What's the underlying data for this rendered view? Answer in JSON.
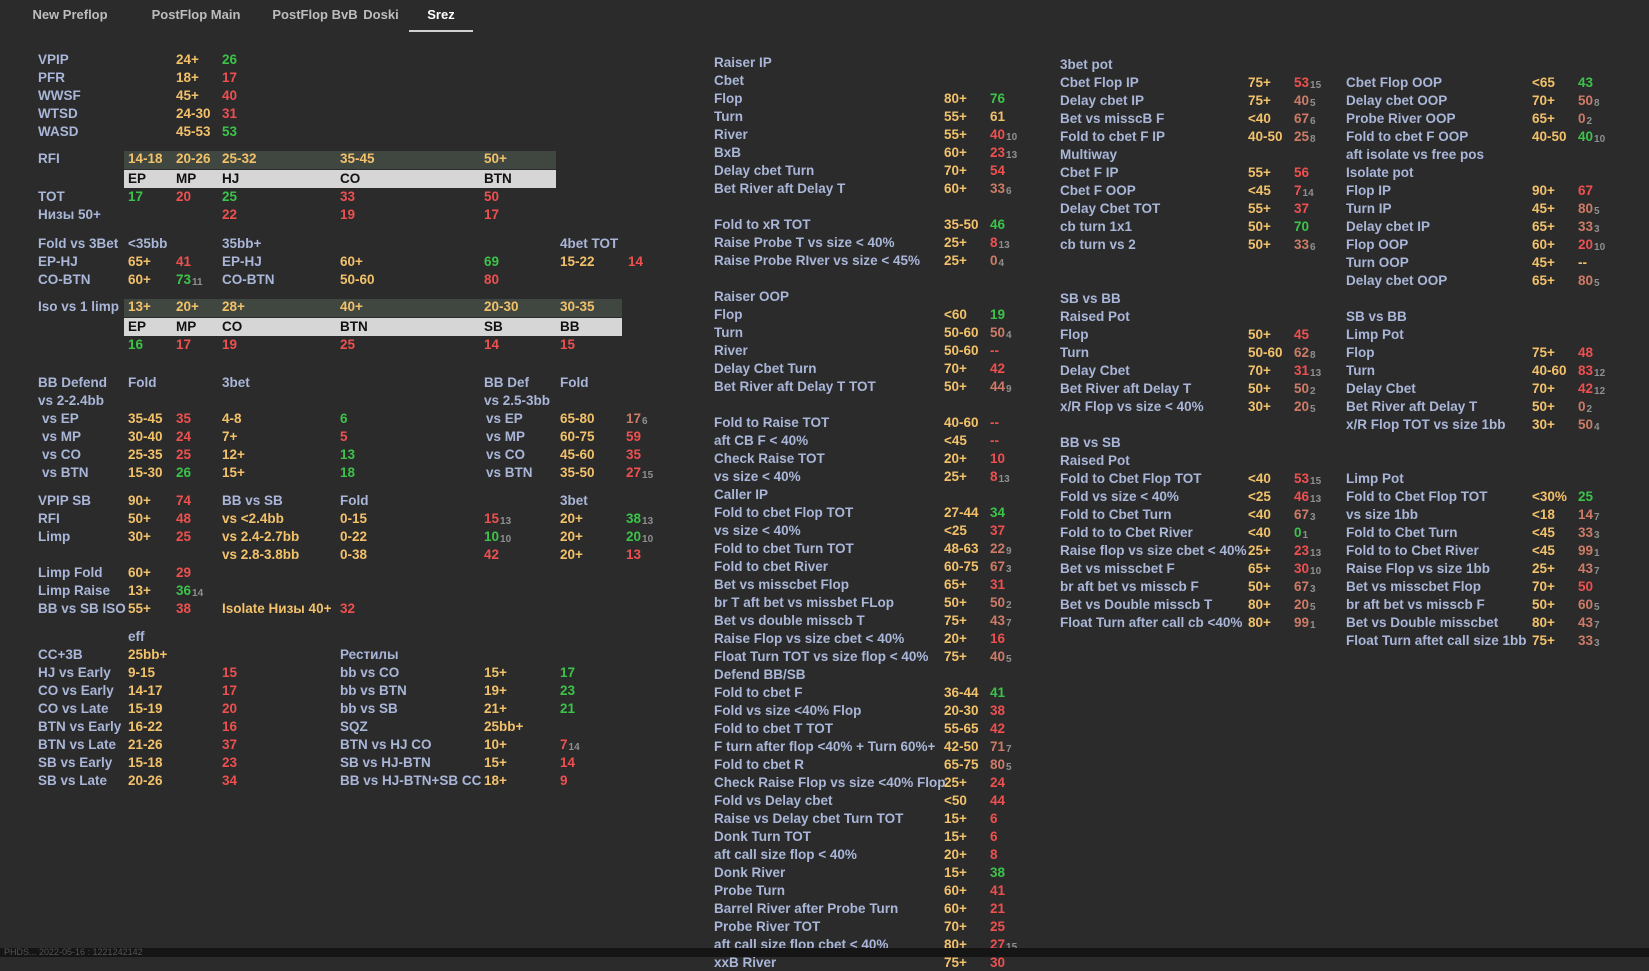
{
  "tabs": [
    {
      "label": "New Preflop"
    },
    {
      "label": "PostFlop Main"
    },
    {
      "label": "PostFlop BvB"
    },
    {
      "label": "Doski"
    },
    {
      "label": "Srez"
    }
  ],
  "top": [
    [
      "VPIP",
      "24+",
      "26",
      "g"
    ],
    [
      "PFR",
      "18+",
      "17",
      "r"
    ],
    [
      "WWSF",
      "45+",
      "40",
      "r"
    ],
    [
      "WTSD",
      "24-30",
      "31",
      "r"
    ],
    [
      "WASD",
      "45-53",
      "53",
      "g"
    ]
  ],
  "rfi": {
    "label": "RFI",
    "thr": [
      "14-18",
      "20-26",
      "25-32",
      "35-45",
      "50+"
    ],
    "pos": [
      "EP",
      "MP",
      "HJ",
      "CO",
      "BTN"
    ],
    "tot_label": "TOT",
    "tot": [
      [
        "17",
        "g"
      ],
      [
        "20",
        "r"
      ],
      [
        "25",
        "g"
      ],
      [
        "33",
        "r"
      ],
      [
        "50",
        "r"
      ]
    ],
    "niz_label": "Низы 50+",
    "niz": [
      "22",
      "19",
      "17"
    ]
  },
  "f3b": {
    "label": "Fold vs 3Bet",
    "h1": "<35bb",
    "h2": "35bb+",
    "h3": "4bet TOT",
    "ep": "EP-HJ",
    "ep_t": "65+",
    "ep_v": "41",
    "ep2": "EP-HJ",
    "ep2_t": "60+",
    "ep2_v": "69",
    "bt_t": "15-22",
    "bt_v": "14",
    "co": "CO-BTN",
    "co_t": "60+",
    "co_v": "73",
    "co_s": "11",
    "co2": "CO-BTN",
    "co2_t": "50-60",
    "co2_v": "80"
  },
  "iso": {
    "label": "Iso vs 1 limp",
    "thr": [
      "13+",
      "20+",
      "28+",
      "40+",
      "20-30",
      "30-35"
    ],
    "pos": [
      "EP",
      "MP",
      "CO",
      "BTN",
      "SB",
      "BB"
    ],
    "vals": [
      [
        "16",
        "g"
      ],
      [
        "17",
        "r"
      ],
      [
        "19",
        "r"
      ],
      [
        "25",
        "r"
      ],
      [
        "14",
        "r"
      ],
      [
        "15",
        "r"
      ]
    ]
  },
  "bbd": {
    "l1": "BB Defend",
    "l2": "vs 2-2.4bb",
    "h_fold": "Fold",
    "h_3bet": "3bet",
    "r_l1": "BB Def",
    "r_l2": "vs 2.5-3bb",
    "r_fold": "Fold",
    "rows": [
      [
        "vs EP",
        "35-45",
        "35",
        "r",
        "4-8",
        "6",
        "g",
        "vs EP",
        "65-80",
        "17",
        "p",
        "6"
      ],
      [
        "vs MP",
        "30-40",
        "24",
        "r",
        "7+",
        "5",
        "r",
        "vs MP",
        "60-75",
        "59",
        "r",
        ""
      ],
      [
        "vs CO",
        "25-35",
        "25",
        "r",
        "12+",
        "13",
        "g",
        "vs CO",
        "45-60",
        "35",
        "r",
        ""
      ],
      [
        "vs BTN",
        "15-30",
        "26",
        "g",
        "15+",
        "18",
        "g",
        "vs BTN",
        "35-50",
        "27",
        "r",
        "15"
      ]
    ]
  },
  "sb": {
    "vpip": "VPIP SB",
    "vpip_t": "90+",
    "vpip_v": "74",
    "rfi": "RFI",
    "rfi_t": "50+",
    "rfi_v": "48",
    "limp": "Limp",
    "limp_t": "30+",
    "limp_v": "25",
    "bbsb": "BB vs SB",
    "fold": "Fold",
    "threebet": "3bet",
    "rows": [
      [
        "vs <2.4bb",
        "0-15",
        "15",
        "r",
        "13",
        "20+",
        "38",
        "g",
        "13"
      ],
      [
        "vs 2.4-2.7bb",
        "0-22",
        "10",
        "g",
        "10",
        "20+",
        "20",
        "g",
        "10"
      ],
      [
        "vs 2.8-3.8bb",
        "0-38",
        "42",
        "r",
        "",
        "20+",
        "13",
        "r",
        ""
      ]
    ]
  },
  "limp": [
    [
      "Limp Fold",
      "60+",
      "29",
      "r",
      ""
    ],
    [
      "Limp Raise",
      "13+",
      "36",
      "g",
      "14"
    ],
    [
      "BB vs SB ISO",
      "55+",
      "38",
      "r",
      ""
    ]
  ],
  "isoniz": {
    "label": "Isolate Низы 40+",
    "v": "32"
  },
  "cc": {
    "eff": "eff",
    "label": "CC+3B",
    "h": "25bb+",
    "rows": [
      [
        "HJ vs Early",
        "9-15",
        "15",
        "r"
      ],
      [
        "CO vs Early",
        "14-17",
        "17",
        "r"
      ],
      [
        "CO vs Late",
        "15-19",
        "20",
        "r"
      ],
      [
        "BTN vs Early",
        "16-22",
        "16",
        "r"
      ],
      [
        "BTN vs Late",
        "21-26",
        "37",
        "r"
      ],
      [
        "SB vs Early",
        "15-18",
        "23",
        "r"
      ],
      [
        "SB vs Late",
        "20-26",
        "34",
        "r"
      ]
    ]
  },
  "rest": {
    "label": "Рестилы",
    "rows": [
      [
        "bb vs CO",
        "15+",
        "17",
        "g",
        ""
      ],
      [
        "bb vs BTN",
        "19+",
        "23",
        "g",
        ""
      ],
      [
        "bb vs SB",
        "21+",
        "21",
        "g",
        ""
      ],
      [
        "SQZ",
        "25bb+",
        "",
        "",
        ""
      ],
      [
        "BTN vs HJ CO",
        "10+",
        "7",
        "r",
        "14"
      ],
      [
        "SB vs HJ-BTN",
        "15+",
        "14",
        "r",
        ""
      ],
      [
        "BB vs HJ-BTN+SB CC",
        "18+",
        "9",
        "r",
        ""
      ]
    ]
  },
  "col2": [
    [
      "Raiser IP",
      "",
      "",
      "",
      ""
    ],
    [
      "Cbet",
      "",
      "",
      "",
      ""
    ],
    [
      "Flop",
      "80+",
      "76",
      "g",
      ""
    ],
    [
      "Turn",
      "55+",
      "61",
      "y",
      ""
    ],
    [
      "River",
      "55+",
      "40",
      "r",
      "10"
    ],
    [
      "BxB",
      "60+",
      "23",
      "r",
      "13"
    ],
    [
      "Delay cbet Turn",
      "70+",
      "54",
      "r",
      ""
    ],
    [
      "Bet River aft Delay T",
      "60+",
      "33",
      "p",
      "6"
    ],
    [
      "",
      "",
      "",
      "",
      ""
    ],
    [
      "Fold to xR TOT",
      "35-50",
      "46",
      "g",
      ""
    ],
    [
      "Raise Probe T vs size  < 40%",
      "25+",
      "8",
      "r",
      "13"
    ],
    [
      "Raise Probe RIver  vs size  < 45%",
      "25+",
      "0",
      "p",
      "4"
    ],
    [
      "",
      "",
      "",
      "",
      ""
    ],
    [
      "Raiser OOP",
      "",
      "",
      "",
      ""
    ],
    [
      "Flop",
      "<60",
      "19",
      "g",
      ""
    ],
    [
      "Turn",
      "50-60",
      "50",
      "p",
      "4"
    ],
    [
      "River",
      "50-60",
      "--",
      "r",
      ""
    ],
    [
      "Delay Cbet Turn",
      "70+",
      "42",
      "r",
      ""
    ],
    [
      "Bet River aft Delay T TOT",
      "50+",
      "44",
      "p",
      "9"
    ],
    [
      "",
      "",
      "",
      "",
      ""
    ],
    [
      "Fold to Raise TOT",
      "40-60",
      "--",
      "r",
      ""
    ],
    [
      "aft CB F < 40%",
      "<45",
      "--",
      "r",
      ""
    ],
    [
      "Check Raise TOT",
      "20+",
      "10",
      "r",
      ""
    ],
    [
      "vs size < 40%",
      "25+",
      "8",
      "r",
      "13"
    ],
    [
      "Caller IP",
      "",
      "",
      "",
      ""
    ],
    [
      "Fold to cbet Flop TOT",
      "27-44",
      "34",
      "g",
      ""
    ],
    [
      "vs size < 40%",
      "<25",
      "37",
      "r",
      ""
    ],
    [
      "Fold to cbet Turn TOT",
      "48-63",
      "22",
      "p",
      "9"
    ],
    [
      "Fold to cbet River",
      "60-75",
      "67",
      "p",
      "3"
    ],
    [
      "Bet vs misscbet Flop",
      "65+",
      "31",
      "r",
      ""
    ],
    [
      "br T aft bet vs missbet FLop",
      "50+",
      "50",
      "p",
      "2"
    ],
    [
      "Bet vs double misscb T",
      "75+",
      "43",
      "p",
      "7"
    ],
    [
      "Raise Flop vs size cbet < 40%",
      "20+",
      "16",
      "r",
      ""
    ],
    [
      "Float Turn TOT vs size flop < 40%",
      "75+",
      "40",
      "p",
      "5"
    ],
    [
      "Defend BB/SB",
      "",
      "",
      "",
      ""
    ],
    [
      "Fold to cbet F",
      "36-44",
      "41",
      "g",
      ""
    ],
    [
      "Fold vs size <40% Flop",
      "20-30",
      "38",
      "r",
      ""
    ],
    [
      "Fold to cbet T TOT",
      "55-65",
      "42",
      "r",
      ""
    ],
    [
      "F turn after flop <40% + Turn 60%+",
      "42-50",
      "71",
      "p",
      "7"
    ],
    [
      "Fold to cbet R",
      "65-75",
      "80",
      "p",
      "5"
    ],
    [
      "Check Raise Flop vs size <40% Flop",
      "25+",
      "24",
      "r",
      ""
    ],
    [
      "Fold vs Delay cbet",
      "<50",
      "44",
      "r",
      ""
    ],
    [
      "Raise vs Delay cbet Turn TOT",
      "15+",
      "6",
      "r",
      ""
    ],
    [
      "Donk Turn TOT",
      "15+",
      "6",
      "r",
      ""
    ],
    [
      "aft call  size flop < 40%",
      "20+",
      "8",
      "r",
      ""
    ],
    [
      "Donk River",
      "15+",
      "38",
      "g",
      ""
    ],
    [
      "Probe Turn",
      "60+",
      "41",
      "r",
      ""
    ],
    [
      "Barrel River  after Probe Turn",
      "60+",
      "21",
      "r",
      ""
    ],
    [
      "Probe River TOT",
      "70+",
      "25",
      "r",
      ""
    ],
    [
      "aft call size flop cbet < 40%",
      "80+",
      "27",
      "r",
      "15"
    ],
    [
      "xxB River",
      "75+",
      "30",
      "r",
      ""
    ]
  ],
  "col3": [
    [
      "3bet pot",
      "",
      "",
      "",
      ""
    ],
    [
      "Cbet Flop IP",
      "75+",
      "53",
      "r",
      "15"
    ],
    [
      "Delay cbet IP",
      "75+",
      "40",
      "p",
      "5"
    ],
    [
      "Bet vs misscB F",
      "<40",
      "67",
      "p",
      "6"
    ],
    [
      "Fold to cbet F IP",
      "40-50",
      "25",
      "p",
      "8"
    ],
    [
      "Multiway",
      "",
      "",
      "",
      ""
    ],
    [
      "Cbet F IP",
      "55+",
      "56",
      "r",
      ""
    ],
    [
      "Cbet F OOP",
      "<45",
      "7",
      "r",
      "14"
    ],
    [
      "Delay Cbet  TOT",
      "55+",
      "37",
      "r",
      ""
    ],
    [
      "cb turn 1x1",
      "50+",
      "70",
      "g",
      ""
    ],
    [
      "cb turn vs 2",
      "50+",
      "33",
      "p",
      "6"
    ],
    [
      "",
      "",
      "",
      "",
      ""
    ],
    [
      "",
      "",
      "",
      "",
      ""
    ],
    [
      "SB vs BB",
      "",
      "",
      "",
      ""
    ],
    [
      "Raised Pot",
      "",
      "",
      "",
      ""
    ],
    [
      "Flop",
      "50+",
      "45",
      "r",
      ""
    ],
    [
      "Turn",
      "50-60",
      "62",
      "p",
      "8"
    ],
    [
      "Delay Cbet",
      "70+",
      "31",
      "r",
      "13"
    ],
    [
      "Bet River aft Delay T",
      "50+",
      "50",
      "p",
      "2"
    ],
    [
      "x/R Flop vs size < 40%",
      "30+",
      "20",
      "p",
      "5"
    ],
    [
      "",
      "",
      "",
      "",
      ""
    ],
    [
      "BB vs SB",
      "",
      "",
      "",
      ""
    ],
    [
      "Raised Pot",
      "",
      "",
      "",
      ""
    ],
    [
      "Fold to Cbet Flop TOT",
      "<40",
      "53",
      "r",
      "15"
    ],
    [
      "Fold vs size < 40%",
      "<25",
      "46",
      "r",
      "13"
    ],
    [
      "Fold to Cbet Turn",
      "<40",
      "67",
      "p",
      "3"
    ],
    [
      "Fold to to Cbet River",
      "<40",
      "0",
      "g",
      "1"
    ],
    [
      "Raise flop vs size cbet < 40%",
      "25+",
      "23",
      "r",
      "13"
    ],
    [
      "Bet vs misscbet F",
      "65+",
      "30",
      "r",
      "10"
    ],
    [
      "br aft bet vs misscb F",
      "50+",
      "67",
      "p",
      "3"
    ],
    [
      "Bet vs Double misscb T",
      "80+",
      "20",
      "p",
      "5"
    ],
    [
      "Float Turn after call cb <40%",
      "80+",
      "99",
      "p",
      "1"
    ]
  ],
  "col4": [
    [
      "",
      "",
      "",
      "",
      ""
    ],
    [
      "Cbet Flop OOP",
      "<65",
      "43",
      "g",
      ""
    ],
    [
      "Delay cbet OOP",
      "70+",
      "50",
      "p",
      "8"
    ],
    [
      "Probe River OOP",
      "65+",
      "0",
      "p",
      "2"
    ],
    [
      "Fold to cbet F OOP",
      "40-50",
      "40",
      "g",
      "10"
    ],
    [
      "aft isolate vs free pos",
      "",
      "",
      "",
      ""
    ],
    [
      "Isolate pot",
      "",
      "",
      "",
      ""
    ],
    [
      "Flop IP",
      "90+",
      "67",
      "r",
      ""
    ],
    [
      "Turn IP",
      "45+",
      "80",
      "p",
      "5"
    ],
    [
      "Delay cbet IP",
      "65+",
      "33",
      "p",
      "3"
    ],
    [
      "Flop OOP",
      "60+",
      "20",
      "r",
      "10"
    ],
    [
      "Turn OOP",
      "45+",
      "--",
      "y",
      ""
    ],
    [
      "Delay cbet OOP",
      "65+",
      "80",
      "p",
      "5"
    ],
    [
      "",
      "",
      "",
      "",
      ""
    ],
    [
      "SB vs BB",
      "",
      "",
      "",
      ""
    ],
    [
      "Limp Pot",
      "",
      "",
      "",
      ""
    ],
    [
      "Flop",
      "75+",
      "48",
      "r",
      ""
    ],
    [
      "Turn",
      "40-60",
      "83",
      "r",
      "12"
    ],
    [
      "Delay Cbet",
      "70+",
      "42",
      "r",
      "12"
    ],
    [
      "Bet River aft Delay T",
      "50+",
      "0",
      "p",
      "2"
    ],
    [
      "x/R Flop TOT vs size 1bb",
      "30+",
      "50",
      "p",
      "4"
    ],
    [
      "",
      "",
      "",
      "",
      ""
    ],
    [
      "",
      "",
      "",
      "",
      ""
    ],
    [
      "Limp Pot",
      "",
      "",
      "",
      ""
    ],
    [
      "Fold to Cbet Flop TOT",
      "<30%",
      "25",
      "g",
      ""
    ],
    [
      "vs size 1bb",
      "<18",
      "14",
      "p",
      "7"
    ],
    [
      "Fold to Cbet Turn",
      "<45",
      "33",
      "p",
      "3"
    ],
    [
      "Fold to to Cbet River",
      "<45",
      "99",
      "p",
      "1"
    ],
    [
      "Raise Flop vs size 1bb",
      "25+",
      "43",
      "p",
      "7"
    ],
    [
      "Bet vs misscbet Flop",
      "70+",
      "50",
      "r",
      ""
    ],
    [
      "br aft bet vs misscb F",
      "50+",
      "60",
      "p",
      "5"
    ],
    [
      "Bet vs Double misscbet",
      "80+",
      "43",
      "p",
      "7"
    ],
    [
      "Float Turn aftet call size 1bb",
      "75+",
      "33",
      "p",
      "3"
    ]
  ],
  "footer": "PHDS... 2022-05-16 : 1221242142"
}
